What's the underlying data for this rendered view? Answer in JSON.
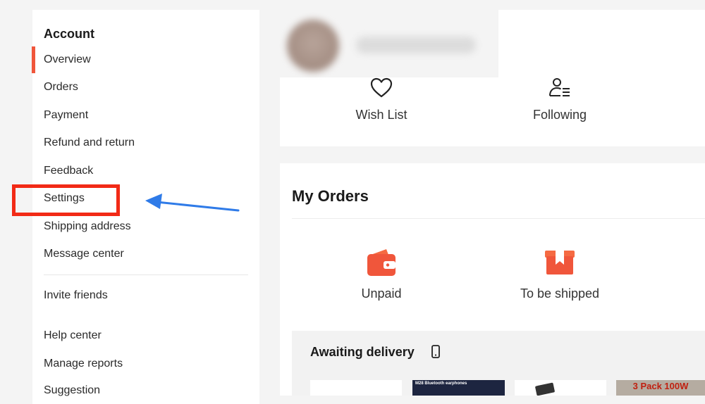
{
  "sidebar": {
    "heading": "Account",
    "items": [
      {
        "label": "Overview",
        "active": true
      },
      {
        "label": "Orders"
      },
      {
        "label": "Payment"
      },
      {
        "label": "Refund and return"
      },
      {
        "label": "Feedback"
      },
      {
        "label": "Settings",
        "highlighted": true
      },
      {
        "label": "Shipping address"
      },
      {
        "label": "Message center"
      },
      {
        "label": "Invite friends"
      },
      {
        "label": "Help center"
      },
      {
        "label": "Manage reports"
      },
      {
        "label": "Suggestion"
      }
    ]
  },
  "profile": {
    "quick_links": [
      {
        "label": "Wish List",
        "icon": "heart-icon"
      },
      {
        "label": "Following",
        "icon": "following-icon"
      }
    ]
  },
  "orders": {
    "title": "My Orders",
    "statuses": [
      {
        "label": "Unpaid",
        "icon": "wallet-icon"
      },
      {
        "label": "To be shipped",
        "icon": "package-icon"
      }
    ],
    "awaiting": {
      "title": "Awaiting delivery",
      "icon": "phone-icon",
      "thumb_captions": [
        "M28 Bluetooth earphones",
        "3 Pack 100W"
      ]
    }
  },
  "colors": {
    "accent": "#f0563b",
    "annotation_box": "#f22a16",
    "annotation_arrow": "#2f7be8"
  }
}
